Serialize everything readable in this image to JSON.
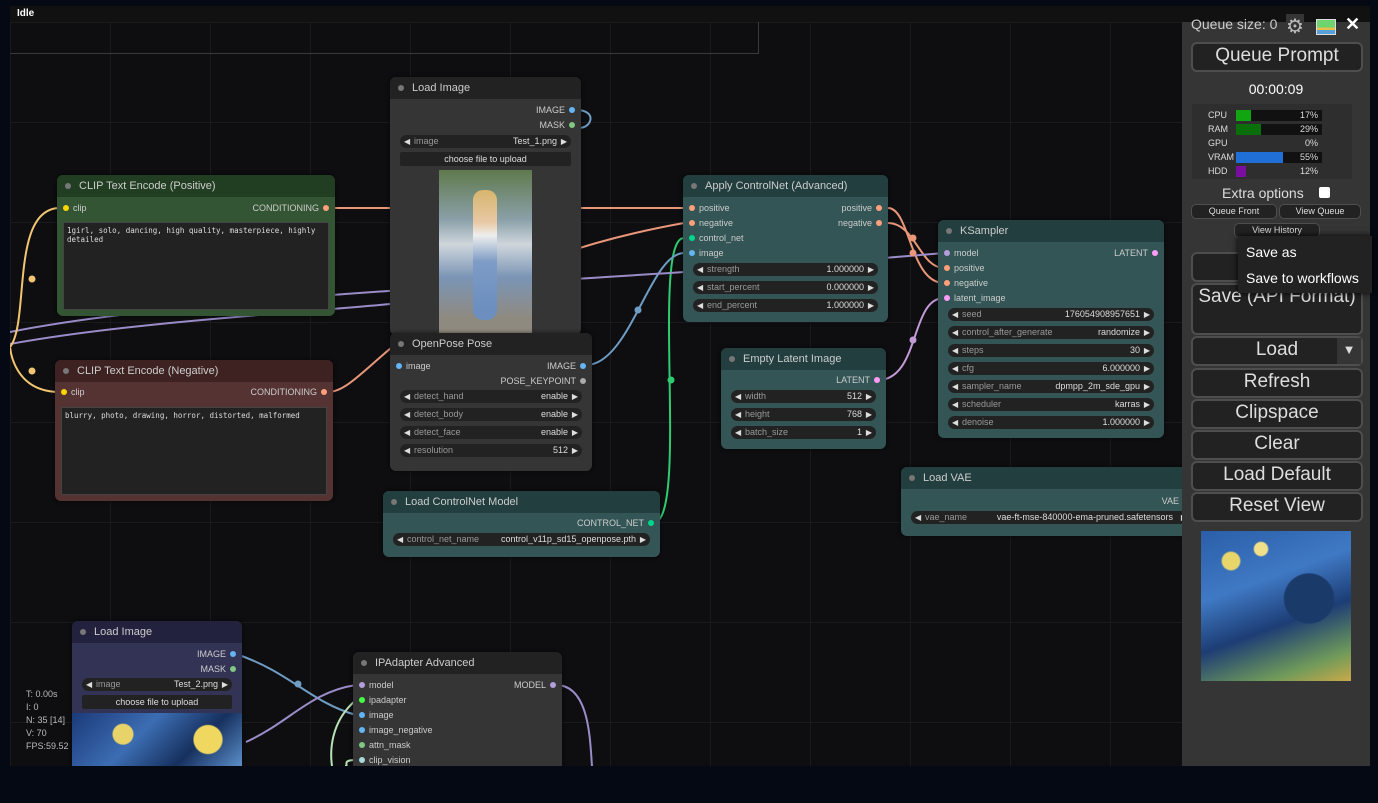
{
  "status_bar": {
    "title": "Idle"
  },
  "stats": {
    "t": "T: 0.00s",
    "i": "I: 0",
    "n": "N: 35 [14]",
    "v": "V: 70",
    "fps": "FPS:59.52"
  },
  "colors": {
    "model": "#b39ddb",
    "conditioning": "#ffa07a",
    "image": "#64b5f6",
    "mask": "#81c784",
    "control_net": "#00d78d",
    "latent": "#ff9cf9",
    "clip": "#ffd500",
    "vae": "#ff6e6e",
    "ipadapter": "#45ff45"
  },
  "nodes": {
    "clip_pos": {
      "title": "CLIP Text Encode (Positive)",
      "in_clip": "clip",
      "out": "CONDITIONING",
      "text": "1girl, solo, dancing, high quality, masterpiece, highly detailed"
    },
    "clip_neg": {
      "title": "CLIP Text Encode (Negative)",
      "in_clip": "clip",
      "out": "CONDITIONING",
      "text": "blurry, photo, drawing, horror, distorted, malformed"
    },
    "load_image_1": {
      "title": "Load Image",
      "out_image": "IMAGE",
      "out_mask": "MASK",
      "w_label": "image",
      "w_value": "Test_1.png",
      "upload": "choose file to upload"
    },
    "openpose": {
      "title": "OpenPose Pose",
      "in_image": "image",
      "out_image": "IMAGE",
      "out_kp": "POSE_KEYPOINT",
      "widgets": [
        {
          "label": "detect_hand",
          "value": "enable"
        },
        {
          "label": "detect_body",
          "value": "enable"
        },
        {
          "label": "detect_face",
          "value": "enable"
        },
        {
          "label": "resolution",
          "value": "512"
        }
      ]
    },
    "load_controlnet": {
      "title": "Load ControlNet Model",
      "out": "CONTROL_NET",
      "w_label": "control_net_name",
      "w_value": "control_v11p_sd15_openpose.pth"
    },
    "apply_cn": {
      "title": "Apply ControlNet (Advanced)",
      "in_pos": "positive",
      "in_neg": "negative",
      "in_cn": "control_net",
      "in_image": "image",
      "out_pos": "positive",
      "out_neg": "negative",
      "widgets": [
        {
          "label": "strength",
          "value": "1.000000"
        },
        {
          "label": "start_percent",
          "value": "0.000000"
        },
        {
          "label": "end_percent",
          "value": "1.000000"
        }
      ]
    },
    "empty_latent": {
      "title": "Empty Latent Image",
      "out": "LATENT",
      "widgets": [
        {
          "label": "width",
          "value": "512"
        },
        {
          "label": "height",
          "value": "768"
        },
        {
          "label": "batch_size",
          "value": "1"
        }
      ]
    },
    "ksampler": {
      "title": "KSampler",
      "in_model": "model",
      "in_pos": "positive",
      "in_neg": "negative",
      "in_latent": "latent_image",
      "out": "LATENT",
      "widgets": [
        {
          "label": "seed",
          "value": "176054908957651"
        },
        {
          "label": "control_after_generate",
          "value": "randomize"
        },
        {
          "label": "steps",
          "value": "30"
        },
        {
          "label": "cfg",
          "value": "6.000000"
        },
        {
          "label": "sampler_name",
          "value": "dpmpp_2m_sde_gpu"
        },
        {
          "label": "scheduler",
          "value": "karras"
        },
        {
          "label": "denoise",
          "value": "1.000000"
        }
      ]
    },
    "load_vae": {
      "title": "Load VAE",
      "out": "VAE",
      "w_label": "vae_name",
      "w_value": "vae-ft-mse-840000-ema-pruned.safetensors"
    },
    "load_image_2": {
      "title": "Load Image",
      "out_image": "IMAGE",
      "out_mask": "MASK",
      "w_label": "image",
      "w_value": "Test_2.png",
      "upload": "choose file to upload"
    },
    "ipadapter": {
      "title": "IPAdapter Advanced",
      "out": "MODEL",
      "inputs": [
        "model",
        "ipadapter",
        "image",
        "image_negative",
        "attn_mask",
        "clip_vision"
      ]
    }
  },
  "panel": {
    "queue_size": "Queue size: 0",
    "queue_prompt": "Queue Prompt",
    "timer": "00:00:09",
    "monitors": [
      {
        "label": "CPU",
        "pct": "17%",
        "value": 17,
        "color": "#11a511"
      },
      {
        "label": "RAM",
        "pct": "29%",
        "value": 29,
        "color": "#0a6e0a"
      },
      {
        "label": "GPU",
        "pct": "0%",
        "value": 0,
        "color": "#0a6e0a"
      },
      {
        "label": "VRAM",
        "pct": "55%",
        "value": 55,
        "color": "#1f6fd6"
      },
      {
        "label": "HDD",
        "pct": "12%",
        "value": 12,
        "color": "#7a0ea0"
      }
    ],
    "extra_options": "Extra options",
    "queue_front": "Queue Front",
    "view_queue": "View Queue",
    "view_history": "View History",
    "save_api": "Save (API Format)",
    "load": "Load",
    "load_arrow": "▼",
    "refresh": "Refresh",
    "clipspace": "Clipspace",
    "clear": "Clear",
    "load_default": "Load Default",
    "reset_view": "Reset View",
    "gear": "⚙",
    "close": "✕"
  },
  "menu": {
    "save_as": "Save as",
    "save_to_workflows": "Save to workflows"
  }
}
